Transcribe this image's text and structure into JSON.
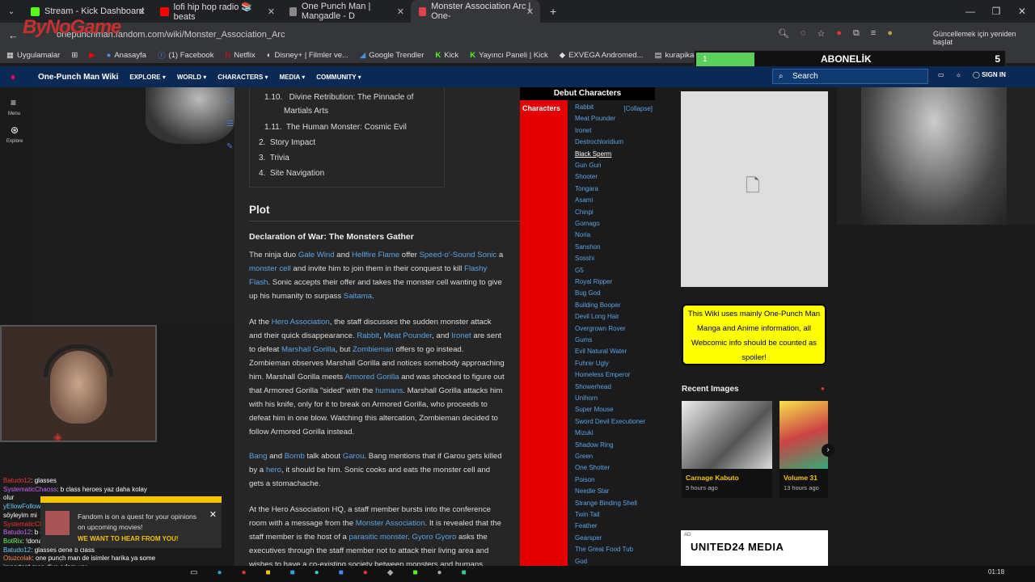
{
  "browser": {
    "tabs": [
      {
        "label": "Stream - Kick Dashboard",
        "color": "#53fc18"
      },
      {
        "label": "lofi hip hop radio 📚 beats",
        "color": "#ff0000"
      },
      {
        "label": "One Punch Man | Mangadle - D",
        "color": "#888888"
      },
      {
        "label": "Monster Association Arc | One-",
        "color": "#e0414c"
      }
    ],
    "url": "onepunchman.fandom.com/wiki/Monster_Association_Arc",
    "update_text": "Güncellemek için yeniden başlat",
    "bookmarks": [
      "Uygulamalar",
      "Anasayfa",
      "(1) Facebook",
      "Netflix",
      "Disney+ | Filmler ve...",
      "Google Trendler",
      "Kick",
      "Yayıncı Paneli | Kick",
      "EXVEGA Andromed...",
      "kurapika - 7TV",
      "Su"
    ]
  },
  "overlay": {
    "logo": "ByNoGame",
    "sub_bar_value": "1",
    "sub_label": "ABONELİK",
    "sub_count": "5"
  },
  "wiki": {
    "title": "One-Punch Man Wiki",
    "nav": [
      "EXPLORE ▾",
      "WORLD ▾",
      "CHARACTERS ▾",
      "MEDIA ▾",
      "COMMUNITY ▾"
    ],
    "search_placeholder": "Search",
    "sign_in": "SIGN IN",
    "rail": [
      "Menu",
      "Explore"
    ]
  },
  "toc": [
    {
      "num": "1.10.",
      "text": "Divine Retribution: The Pinnacle of"
    },
    {
      "num": "",
      "text": "Martials Arts"
    },
    {
      "num": "1.11.",
      "text": "The Human Monster: Cosmic Evil"
    },
    {
      "num": "2.",
      "text": "Story Impact"
    },
    {
      "num": "3.",
      "text": "Trivia"
    },
    {
      "num": "4.",
      "text": "Site Navigation"
    }
  ],
  "article": {
    "heading": "Plot",
    "subheading": "Declaration of War: The Monsters Gather",
    "p1": [
      [
        "The ninja duo ",
        "Gale Wind",
        " and ",
        "Hellfire Flame",
        " offer ",
        "Speed-o'-Sound Sonic",
        " a"
      ],
      [
        "",
        "monster cell",
        " and invite him to join them in their conquest to kill ",
        "Flashy",
        ""
      ],
      [
        "",
        "Flash",
        ". Sonic accepts their offer and takes the monster cell wanting to give",
        "",
        ""
      ],
      [
        "up his humanity to surpass ",
        "Saitama",
        ".",
        "",
        ""
      ]
    ],
    "p2": [
      [
        "At the ",
        "Hero Association",
        ", the staff discusses the sudden monster attack"
      ],
      [
        "and their quick disappearance. ",
        "Rabbit",
        ", ",
        "Meat Pounder",
        ", and ",
        "Ironet",
        " are sent"
      ],
      [
        "to defeat ",
        "Marshall Gorilla",
        ", but ",
        "Zombieman",
        " offers to go instead."
      ],
      [
        "Zombieman observes Marshall Gorilla and notices somebody approaching",
        "",
        ""
      ],
      [
        "him. Marshall Gorilla meets ",
        "Armored Gorilla",
        " and was shocked to figure out"
      ],
      [
        "that Armored Gorilla \"sided\" with the ",
        "humans",
        ". Marshall Gorilla attacks him"
      ],
      [
        "with his knife, only for it to break on Armored Gorilla, who proceeds to",
        "",
        ""
      ],
      [
        "defeat him in one blow. Watching this altercation, Zombieman decided to",
        "",
        ""
      ],
      [
        "follow Armored Gorilla instead.",
        "",
        ""
      ]
    ],
    "p3": [
      [
        "",
        "Bang",
        " and ",
        "Bomb",
        " talk about ",
        "Garou",
        ". Bang mentions that if Garou gets killed"
      ],
      [
        "by a ",
        "hero",
        ", it should be him. Sonic cooks and eats the monster cell and"
      ],
      [
        "gets a stomachache.",
        "",
        ""
      ]
    ],
    "p4": [
      [
        "At the Hero Association HQ, a staff member bursts into the conference",
        "",
        ""
      ],
      [
        "room with a message from the ",
        "Monster Association",
        ". It is revealed that the"
      ],
      [
        "staff member is the host of a ",
        "parasitic monster",
        ". ",
        "Gyoro Gyoro",
        " asks the"
      ],
      [
        "executives through the staff member not to attack their living area and",
        "",
        ""
      ],
      [
        "wishes to have a co-existing society between monsters and humans.",
        "",
        ""
      ]
    ]
  },
  "navbox": {
    "title": "Debut Characters",
    "group": "Characters",
    "collapse": "[Collapse]",
    "items": [
      "Rabbit",
      "Meat Pounder",
      "Ironet",
      "Destrochloridium",
      "Black Sperm",
      "Gun Gun",
      "Shooter",
      "Tongara",
      "Asami",
      "Chinpi",
      "Gomago",
      "Noria",
      "Sanshon",
      "Sosshi",
      "G5",
      "Royal Ripper",
      "Bug God",
      "Building Booper",
      "Devil Long Hair",
      "Overgrown Rover",
      "Gums",
      "Evil Natural Water",
      "Fuhrer Ugly",
      "Homeless Emperor",
      "Showerhead",
      "Unihorn",
      "Super Mouse",
      "Sword Devil Executioner",
      "Mizuki",
      "Shadow Ring",
      "Green",
      "One Shotter",
      "Poison",
      "Needle Star",
      "Strange Binding Shell",
      "Twin Tail",
      "Feather",
      "Gearsper",
      "The Great Food Tub",
      "God"
    ]
  },
  "sidebar": {
    "notice": "This Wiki uses mainly One-Punch Man Manga and Anime information, all Webcomic info should be counted as spoiler!",
    "recent_title": "Recent Images",
    "images": [
      {
        "caption": "Carnage Kabuto",
        "time": "5 hours ago"
      },
      {
        "caption": "Volume 31",
        "time": "13 hours ago"
      }
    ],
    "ad_tag": "AD",
    "ad_text": "UNITED24 MEDIA"
  },
  "chat": [
    {
      "user": "Batudo12",
      "msg": ": glasses"
    },
    {
      "user": "SystematicChaoss",
      "msg": ": b class heroes yaz daha kolay"
    },
    {
      "user": "",
      "msg": "olur"
    },
    {
      "user": "yEllowFollowEr",
      "msg": ": abi ben deneyerek buldum cevabı"
    },
    {
      "user": "",
      "msg": "söyleyim mi"
    },
    {
      "user": "SystematicChaoss",
      "msg": ": gun-gun"
    },
    {
      "user": "Batudo12",
      "msg": ": b class"
    },
    {
      "user": "BotRix",
      "msg": ": !donate !blerp"
    },
    {
      "user": "Batudo12",
      "msg": ": glasses dene b class"
    },
    {
      "user": "Otuzcolak",
      "msg": ": one punch man de isimler harika ya some"
    },
    {
      "user": "",
      "msg": "important men diye adam var"
    }
  ],
  "popup": {
    "text1": "Fandom is on a quest for your opinions",
    "text2": "on upcoming movies!",
    "text3": "WE WANT TO HEAR FROM YOU!"
  },
  "taskbar": {
    "time": "01:18"
  }
}
